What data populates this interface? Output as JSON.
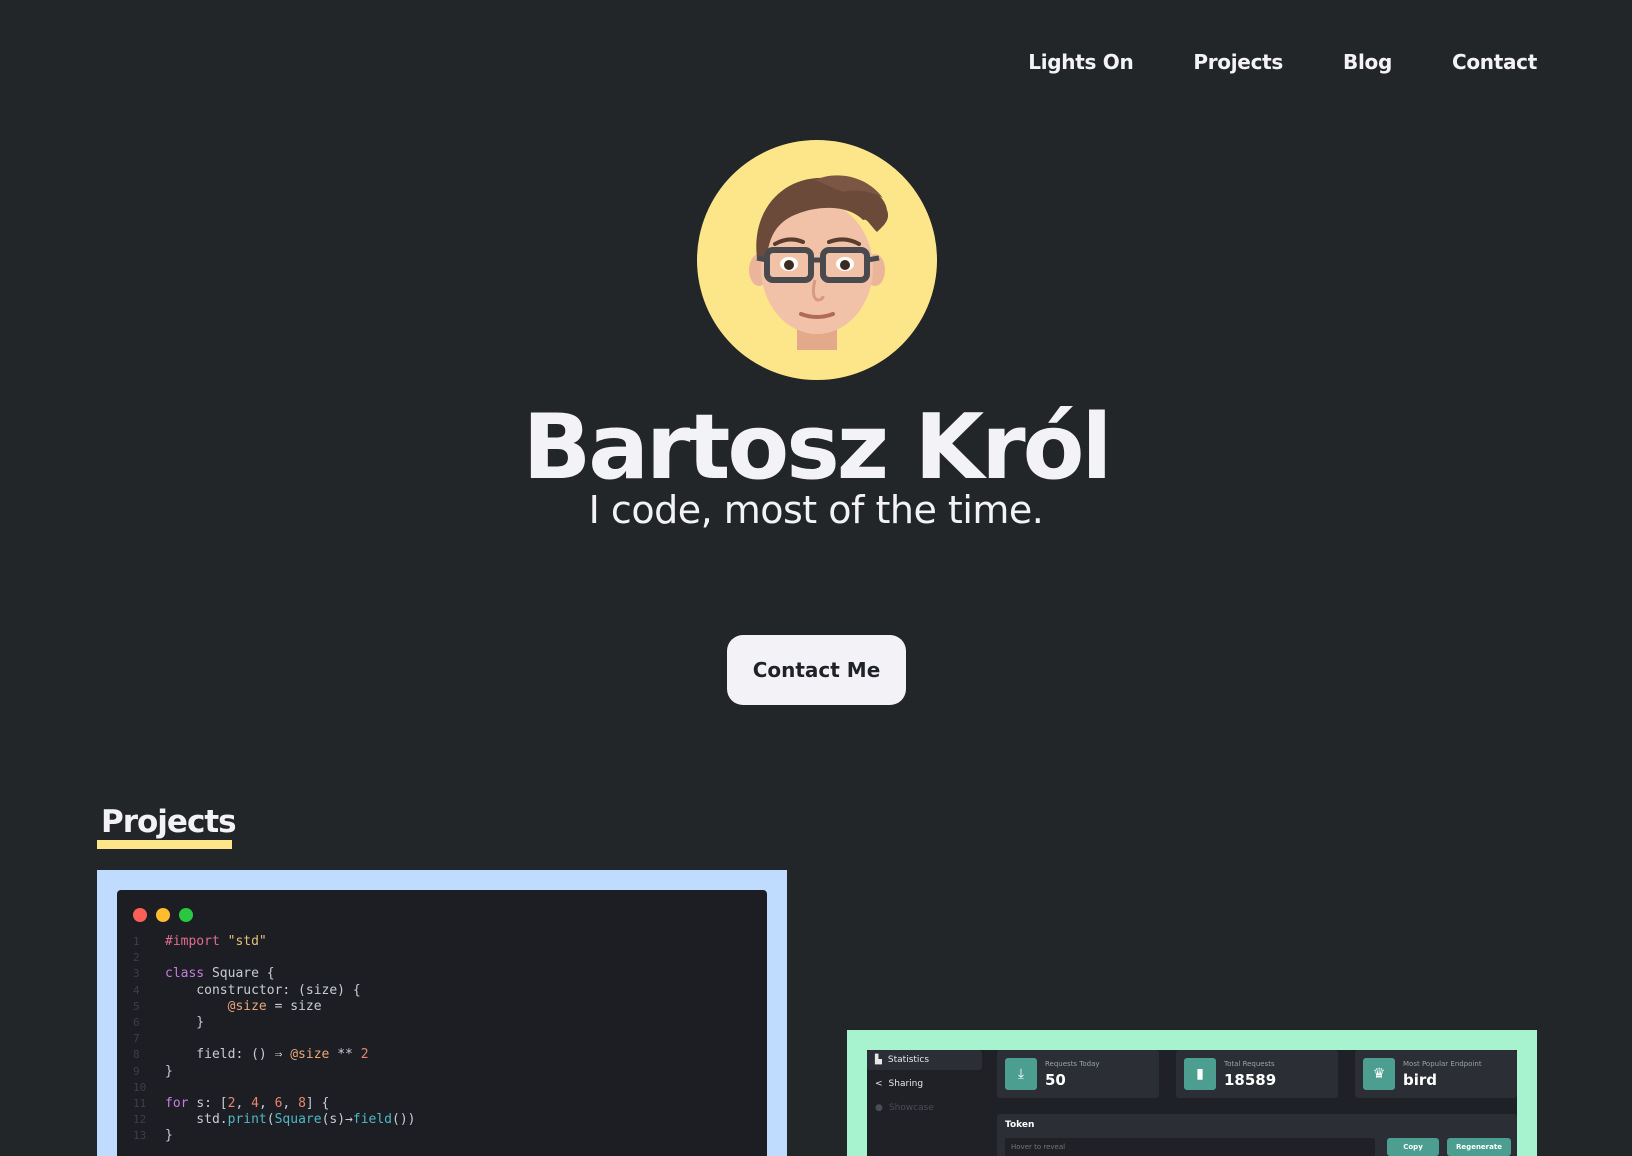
{
  "nav": {
    "items": [
      {
        "label": "Lights On"
      },
      {
        "label": "Projects"
      },
      {
        "label": "Blog"
      },
      {
        "label": "Contact"
      }
    ]
  },
  "hero": {
    "name": "Bartosz Król",
    "tagline": "I code, most of the time.",
    "cta_label": "Contact Me"
  },
  "projects": {
    "title": "Projects",
    "code_card": {
      "lines": [
        {
          "n": "1",
          "segments": [
            {
              "t": "#import ",
              "c": "pp"
            },
            {
              "t": "\"std\"",
              "c": "str"
            }
          ]
        },
        {
          "n": "2",
          "segments": []
        },
        {
          "n": "3",
          "segments": [
            {
              "t": "class ",
              "c": "kw"
            },
            {
              "t": "Square {",
              "c": "code-text"
            }
          ]
        },
        {
          "n": "4",
          "segments": [
            {
              "t": "    constructor: (size) {",
              "c": "code-text"
            }
          ]
        },
        {
          "n": "5",
          "segments": [
            {
              "t": "        ",
              "c": "code-text"
            },
            {
              "t": "@size",
              "c": "at"
            },
            {
              "t": " = size",
              "c": "code-text"
            }
          ]
        },
        {
          "n": "6",
          "segments": [
            {
              "t": "    }",
              "c": "code-text"
            }
          ]
        },
        {
          "n": "7",
          "segments": []
        },
        {
          "n": "8",
          "segments": [
            {
              "t": "    field: () ⇒ ",
              "c": "code-text"
            },
            {
              "t": "@size",
              "c": "at"
            },
            {
              "t": " ** ",
              "c": "code-text"
            },
            {
              "t": "2",
              "c": "num"
            }
          ]
        },
        {
          "n": "9",
          "segments": [
            {
              "t": "}",
              "c": "code-text"
            }
          ]
        },
        {
          "n": "10",
          "segments": []
        },
        {
          "n": "11",
          "segments": [
            {
              "t": "for ",
              "c": "kw"
            },
            {
              "t": "s: [",
              "c": "code-text"
            },
            {
              "t": "2",
              "c": "num"
            },
            {
              "t": ", ",
              "c": "code-text"
            },
            {
              "t": "4",
              "c": "num"
            },
            {
              "t": ", ",
              "c": "code-text"
            },
            {
              "t": "6",
              "c": "num"
            },
            {
              "t": ", ",
              "c": "code-text"
            },
            {
              "t": "8",
              "c": "num"
            },
            {
              "t": "] {",
              "c": "code-text"
            }
          ]
        },
        {
          "n": "12",
          "segments": [
            {
              "t": "    std.",
              "c": "code-text"
            },
            {
              "t": "print",
              "c": "fn"
            },
            {
              "t": "(",
              "c": "code-text"
            },
            {
              "t": "Square",
              "c": "fn"
            },
            {
              "t": "(s)→",
              "c": "code-text"
            },
            {
              "t": "field",
              "c": "fn"
            },
            {
              "t": "())",
              "c": "code-text"
            }
          ]
        },
        {
          "n": "13",
          "segments": [
            {
              "t": "}",
              "c": "code-text"
            }
          ]
        }
      ]
    },
    "dash_card": {
      "sidebar": [
        {
          "label": "Statistics",
          "icon": "chart-icon",
          "glyph": "▙"
        },
        {
          "label": "Sharing",
          "icon": "share-icon",
          "glyph": "<"
        },
        {
          "label": "Showcase",
          "icon": "eye-icon",
          "glyph": "●"
        }
      ],
      "stats": [
        {
          "label": "Requests Today",
          "value": "50",
          "icon": "download-icon",
          "glyph": "⤓"
        },
        {
          "label": "Total Requests",
          "value": "18589",
          "icon": "document-icon",
          "glyph": "▮"
        },
        {
          "label": "Most Popular Endpoint",
          "value": "bird",
          "icon": "trophy-icon",
          "glyph": "♛"
        }
      ],
      "token": {
        "label": "Token",
        "placeholder": "Hover to reveal",
        "copy_label": "Copy",
        "regenerate_label": "Regenerate"
      }
    }
  },
  "colors": {
    "background": "#232629",
    "accent_yellow": "#fde68a",
    "card_blue": "#bfdbfe",
    "card_green": "#a7f3d0",
    "teal": "#4c9f90"
  }
}
